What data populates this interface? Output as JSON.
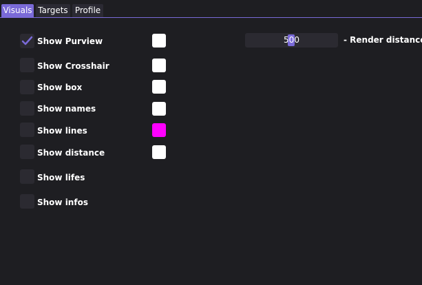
{
  "tabs": [
    "Visuals",
    "Targets",
    "Profile"
  ],
  "active_tab": "Visuals",
  "accent_color": "#7a6ad8",
  "options": [
    {
      "label": "Show Purview",
      "checked": true,
      "color": "#ffffff"
    },
    {
      "label": "Show Crosshair",
      "checked": false,
      "color": "#ffffff"
    },
    {
      "label": "Show box",
      "checked": false,
      "color": "#ffffff"
    },
    {
      "label": "Show names",
      "checked": false,
      "color": "#ffffff"
    },
    {
      "label": "Show lines",
      "checked": false,
      "color": "#ff00ff"
    },
    {
      "label": "Show distance",
      "checked": false,
      "color": "#ffffff"
    },
    {
      "label": "Show lifes",
      "checked": false
    },
    {
      "label": "Show infos",
      "checked": false
    }
  ],
  "render_distance": {
    "value": "500",
    "label": "- Render distance"
  }
}
